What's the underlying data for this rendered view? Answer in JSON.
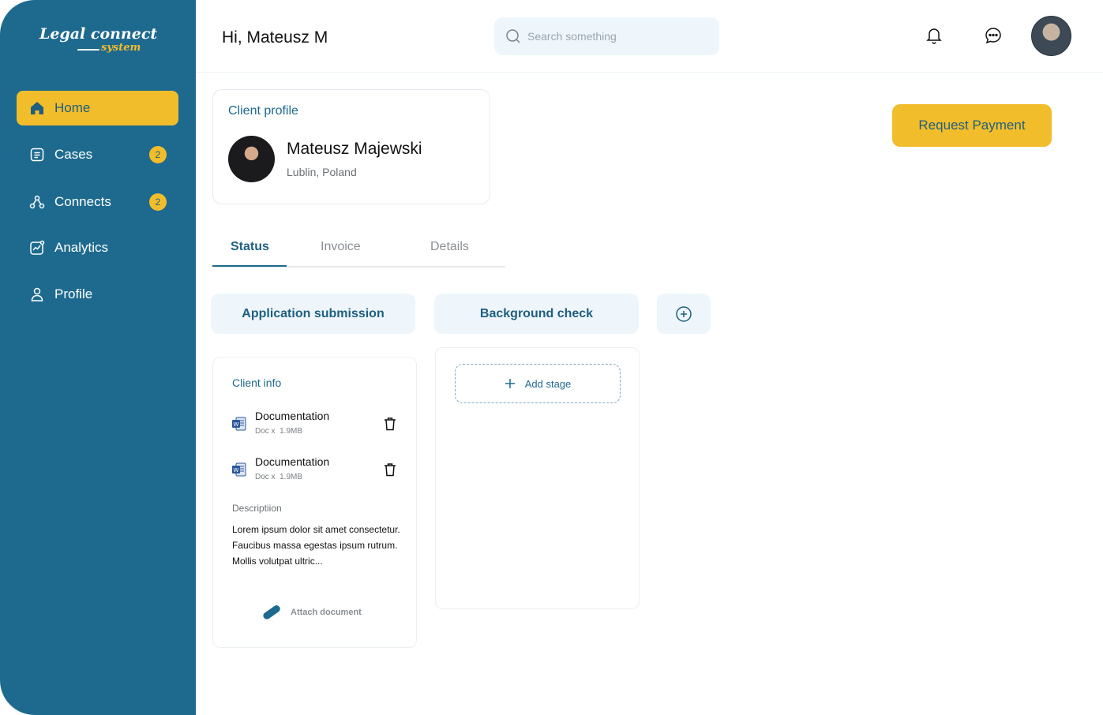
{
  "app": {
    "logo_main": "Legal connect",
    "logo_sub": "system"
  },
  "sidebar": {
    "items": [
      {
        "label": "Home",
        "icon": "home-icon",
        "active": true
      },
      {
        "label": "Cases",
        "icon": "cases-icon",
        "badge": "2"
      },
      {
        "label": "Connects",
        "icon": "connects-icon",
        "badge": "2"
      },
      {
        "label": "Analytics",
        "icon": "analytics-icon"
      },
      {
        "label": "Profile",
        "icon": "profile-icon"
      }
    ]
  },
  "header": {
    "greeting": "Hi, Mateusz M",
    "search_placeholder": "Search something",
    "icons": [
      "bell-icon",
      "chat-icon"
    ]
  },
  "client_profile": {
    "title": "Client profile",
    "name": "Mateusz Majewski",
    "location": "Lublin, Poland"
  },
  "actions": {
    "request_payment": "Request Payment"
  },
  "tabs": [
    {
      "label": "Status",
      "active": true
    },
    {
      "label": "Invoice"
    },
    {
      "label": "Details"
    }
  ],
  "stages": [
    {
      "label": "Application submission"
    },
    {
      "label": "Background check"
    }
  ],
  "client_info": {
    "title": "Client info",
    "documents": [
      {
        "name": "Documentation",
        "type": "Doc x",
        "size": "1.9MB"
      },
      {
        "name": "Documentation",
        "type": "Doc x",
        "size": "1.9MB"
      }
    ],
    "description_label": "Descriptiion",
    "description": "Lorem ipsum dolor sit amet consectetur. Faucibus massa egestas ipsum rutrum. Mollis volutpat ultric...",
    "attach_label": "Attach document"
  },
  "stage_two": {
    "add_stage_label": "Add stage"
  },
  "colors": {
    "sidebar": "#1e6a8f",
    "accent": "#f2bd2b",
    "primary_text": "#1e5f80",
    "light_bg": "#eef6fb"
  }
}
